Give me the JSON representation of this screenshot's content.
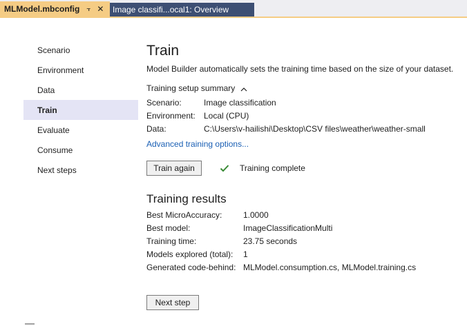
{
  "tabs": {
    "active": {
      "title": "MLModel.mbconfig",
      "pin_icon": "pin-icon",
      "close_icon": "close-icon"
    },
    "inactive": {
      "title": "Image classifi...ocal1: Overview"
    },
    "accent_color": "#f5cc84",
    "inactive_color": "#3d4f73"
  },
  "nav": {
    "items": [
      {
        "label": "Scenario"
      },
      {
        "label": "Environment"
      },
      {
        "label": "Data"
      },
      {
        "label": "Train"
      },
      {
        "label": "Evaluate"
      },
      {
        "label": "Consume"
      },
      {
        "label": "Next steps"
      }
    ],
    "selected": "Train"
  },
  "train": {
    "title": "Train",
    "description": "Model Builder automatically sets the training time based on the size of your dataset.",
    "summary_toggle": "Training setup summary",
    "summary": {
      "scenario_label": "Scenario:",
      "scenario_value": "Image classification",
      "environment_label": "Environment:",
      "environment_value": "Local (CPU)",
      "data_label": "Data:",
      "data_value": "C:\\Users\\v-hailishi\\Desktop\\CSV files\\weather\\weather-small"
    },
    "advanced_link": "Advanced training options...",
    "train_again_button": "Train again",
    "status_text": "Training complete",
    "status_color": "#388a34"
  },
  "results": {
    "title": "Training results",
    "rows": [
      {
        "label": "Best MicroAccuracy:",
        "value": "1.0000"
      },
      {
        "label": "Best model:",
        "value": "ImageClassificationMulti"
      },
      {
        "label": "Training time:",
        "value": "23.75 seconds"
      },
      {
        "label": "Models explored (total):",
        "value": "1"
      },
      {
        "label": "Generated code-behind:",
        "value": "MLModel.consumption.cs, MLModel.training.cs"
      }
    ]
  },
  "next_step_button": "Next step"
}
